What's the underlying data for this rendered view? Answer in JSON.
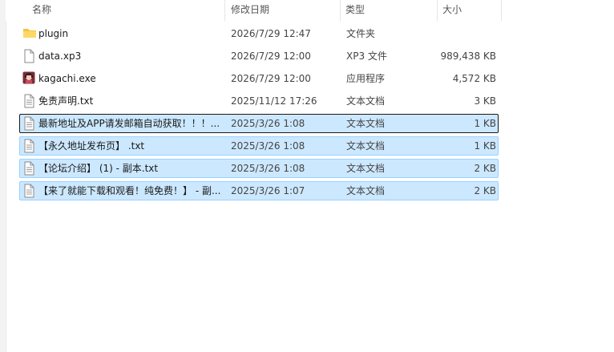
{
  "columns": {
    "name": "名称",
    "date": "修改日期",
    "type": "类型",
    "size": "大小"
  },
  "files": [
    {
      "name": "plugin",
      "date": "2026/7/29 12:47",
      "type": "文件夹",
      "size": "",
      "icon": "folder-icon"
    },
    {
      "name": "data.xp3",
      "date": "2026/7/29 12:00",
      "type": "XP3 文件",
      "size": "989,438 KB",
      "icon": "blank-file-icon"
    },
    {
      "name": "kagachi.exe",
      "date": "2026/7/29 12:00",
      "type": "应用程序",
      "size": "4,572 KB",
      "icon": "app-icon"
    },
    {
      "name": "免责声明.txt",
      "date": "2025/11/12 17:26",
      "type": "文本文档",
      "size": "3 KB",
      "icon": "text-file-icon"
    },
    {
      "name": "最新地址及APP请发邮箱自动获取！！！...",
      "date": "2025/3/26 1:08",
      "type": "文本文档",
      "size": "1 KB",
      "icon": "text-file-icon"
    },
    {
      "name": "【永久地址发布页】 .txt",
      "date": "2025/3/26 1:08",
      "type": "文本文档",
      "size": "1 KB",
      "icon": "text-file-icon"
    },
    {
      "name": "【论坛介绍】 (1) - 副本.txt",
      "date": "2025/3/26 1:08",
      "type": "文本文档",
      "size": "2 KB",
      "icon": "text-file-icon"
    },
    {
      "name": "【来了就能下载和观看！纯免费！】 - 副...",
      "date": "2025/3/26 1:07",
      "type": "文本文档",
      "size": "2 KB",
      "icon": "text-file-icon"
    }
  ],
  "colors": {
    "selection_bg": "#cce8ff",
    "selection_border": "#99d1ff",
    "focus_border": "#1a1a1a",
    "folder": "#f5c142"
  }
}
